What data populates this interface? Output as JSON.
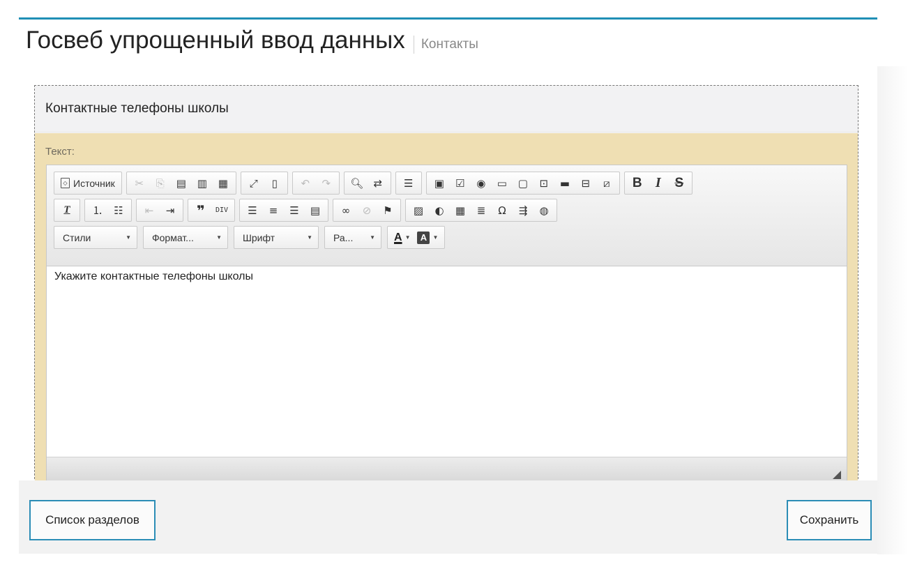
{
  "page": {
    "title": "Госвеб упрощенный ввод данных",
    "subtitle": "Контакты",
    "accent_color": "#1f8fb5"
  },
  "section": {
    "header": "Контактные телефоны школы",
    "field_label": "Текст:"
  },
  "toolbar": {
    "source_label": "Источник",
    "row1_icons": [
      "source-icon",
      "cut-icon",
      "copy-icon",
      "paste-icon",
      "paste-text-icon",
      "paste-word-icon",
      "maximize-icon",
      "show-blocks-icon",
      "undo-icon",
      "redo-icon",
      "find-icon",
      "replace-icon",
      "template-icon",
      "form-icon",
      "checkbox-icon",
      "radio-icon",
      "textfield-icon",
      "textarea-icon",
      "select-icon",
      "button-icon",
      "image-button-icon",
      "hidden-field-icon",
      "bold-icon",
      "italic-icon",
      "strike-icon"
    ],
    "bold_glyph": "B",
    "italic_glyph": "I",
    "strike_glyph": "S",
    "omega_glyph": "Ω",
    "styles_label": "Стили",
    "format_label": "Формат...",
    "font_label": "Шрифт",
    "size_label": "Ра...",
    "text_color_glyph": "A",
    "bg_color_glyph": "A"
  },
  "editor": {
    "content": "Укажите контактные телефоны школы"
  },
  "footer": {
    "sections_button": "Список разделов",
    "save_button": "Сохранить"
  }
}
